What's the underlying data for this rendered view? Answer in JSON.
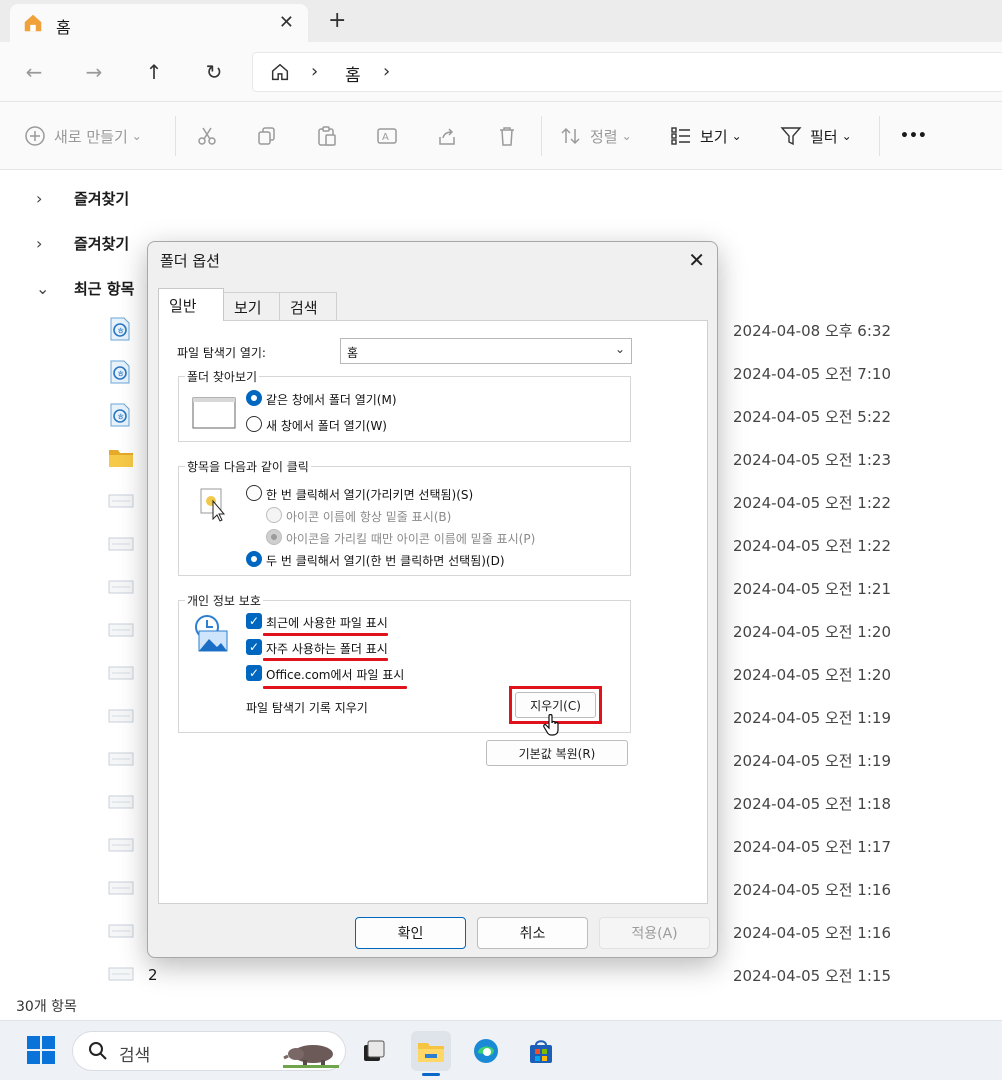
{
  "explorer": {
    "tab_title": "홈",
    "breadcrumb": [
      "홈"
    ],
    "commands": {
      "new": "새로 만들기",
      "sort": "정렬",
      "view": "보기",
      "filter": "필터",
      "more": "•••"
    },
    "tree": [
      "즐겨찾기",
      "즐겨찾기",
      "최근 항목"
    ],
    "files": [
      {
        "name": "",
        "date": "2024-04-08 오후 6:32",
        "icon": "hwp-document-icon"
      },
      {
        "name": "",
        "date": "2024-04-05 오전 7:10",
        "icon": "hwp-document-icon"
      },
      {
        "name": "",
        "date": "2024-04-05 오전 5:22",
        "icon": "hwp-document-icon"
      },
      {
        "name": "",
        "date": "2024-04-05 오전 1:23",
        "icon": "folder-icon"
      },
      {
        "name": "",
        "date": "2024-04-05 오전 1:22",
        "icon": "image-thumbnail-icon"
      },
      {
        "name": "",
        "date": "2024-04-05 오전 1:22",
        "icon": "image-thumbnail-icon"
      },
      {
        "name": "",
        "date": "2024-04-05 오전 1:21",
        "icon": "image-thumbnail-icon"
      },
      {
        "name": "",
        "date": "2024-04-05 오전 1:20",
        "icon": "image-thumbnail-icon"
      },
      {
        "name": "",
        "date": "2024-04-05 오전 1:20",
        "icon": "image-thumbnail-icon"
      },
      {
        "name": "",
        "date": "2024-04-05 오전 1:19",
        "icon": "image-thumbnail-icon"
      },
      {
        "name": "",
        "date": "2024-04-05 오전 1:19",
        "icon": "image-thumbnail-icon"
      },
      {
        "name": "",
        "date": "2024-04-05 오전 1:18",
        "icon": "image-thumbnail-icon"
      },
      {
        "name": "",
        "date": "2024-04-05 오전 1:17",
        "icon": "image-thumbnail-icon"
      },
      {
        "name": "",
        "date": "2024-04-05 오전 1:16",
        "icon": "image-thumbnail-icon"
      },
      {
        "name": "",
        "date": "2024-04-05 오전 1:16",
        "icon": "image-thumbnail-icon"
      },
      {
        "name": "2",
        "date": "2024-04-05 오전 1:15",
        "icon": "image-thumbnail-icon"
      }
    ],
    "status": "30개 항목"
  },
  "dialog": {
    "title": "폴더 옵션",
    "tabs": [
      "일반",
      "보기",
      "검색"
    ],
    "open_explorer_label": "파일 탐색기 열기:",
    "open_explorer_value": "홈",
    "browse_group": {
      "title": "폴더 찾아보기",
      "same_window": "같은 창에서 폴더 열기(M)",
      "new_window": "새 창에서 폴더 열기(W)"
    },
    "click_group": {
      "title": "항목을 다음과 같이 클릭",
      "single_click": "한 번 클릭해서 열기(가리키면 선택됨)(S)",
      "underline_always": "아이콘 이름에 항상 밑줄 표시(B)",
      "underline_hover": "아이콘을 가리킬 때만 아이콘 이름에 밑줄 표시(P)",
      "double_click": "두 번 클릭해서 열기(한 번 클릭하면 선택됨)(D)"
    },
    "privacy_group": {
      "title": "개인 정보 보호",
      "recent_files": "최근에 사용한 파일 표시",
      "frequent_folders": "자주 사용하는 폴더 표시",
      "office_files": "Office.com에서 파일 표시",
      "clear_label": "파일 탐색기 기록 지우기",
      "clear_button": "지우기(C)"
    },
    "restore_defaults": "기본값 복원(R)",
    "ok": "확인",
    "cancel": "취소",
    "apply": "적용(A)"
  },
  "taskbar": {
    "search_placeholder": "검색"
  },
  "colors": {
    "accent": "#0067c0",
    "highlight": "#e0131d"
  }
}
